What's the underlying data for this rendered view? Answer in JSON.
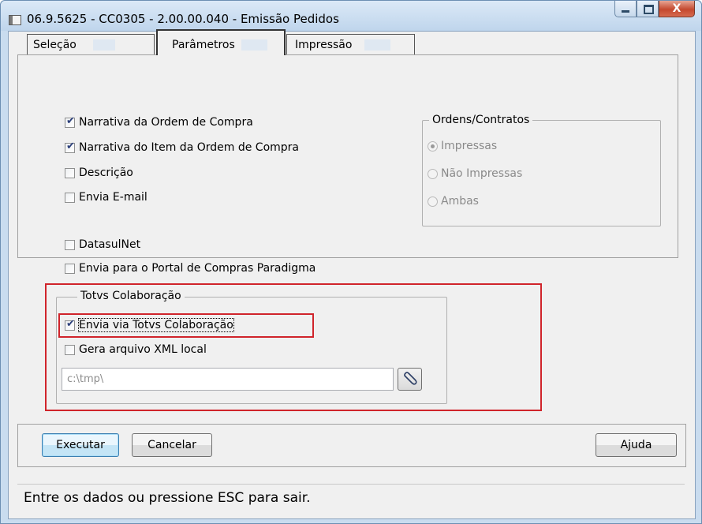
{
  "window": {
    "title": "06.9.5625 - CC0305 - 2.00.00.040 - Emissão Pedidos",
    "close_symbol": "X"
  },
  "tabs": [
    {
      "label": "Seleção",
      "selected": false
    },
    {
      "label": "Parâmetros",
      "selected": true
    },
    {
      "label": "Impressão",
      "selected": false
    }
  ],
  "options": {
    "narrativa_ordem": {
      "label": "Narrativa da Ordem de Compra",
      "checked": true
    },
    "narrativa_item": {
      "label": "Narrativa do Item da Ordem de Compra",
      "checked": true
    },
    "descricao": {
      "label": "Descrição",
      "checked": false
    },
    "envia_email": {
      "label": "Envia E-mail",
      "checked": false
    },
    "datasulnet": {
      "label": "DatasulNet",
      "checked": false
    },
    "portal_paradigma": {
      "label": "Envia para o Portal de Compras Paradigma",
      "checked": false
    }
  },
  "ordens_contratos": {
    "title": "Ordens/Contratos",
    "options": [
      {
        "label": "Impressas",
        "selected": true
      },
      {
        "label": "Não Impressas",
        "selected": false
      },
      {
        "label": "Ambas",
        "selected": false
      }
    ]
  },
  "totvs": {
    "title": "Totvs Colaboração",
    "envia_via": {
      "label": "Envia via Totvs Colaboração",
      "checked": true
    },
    "gera_xml": {
      "label": "Gera arquivo XML local",
      "checked": false
    },
    "path_value": "c:\\tmp\\"
  },
  "buttons": {
    "executar": "Executar",
    "cancelar": "Cancelar",
    "ajuda": "Ajuda"
  },
  "status_text": "Entre os dados ou pressione ESC para sair.",
  "colors": {
    "highlight_red": "#d0242b",
    "checkmark": "#2b3f7a"
  },
  "icons": {
    "browse": "clip-icon"
  }
}
